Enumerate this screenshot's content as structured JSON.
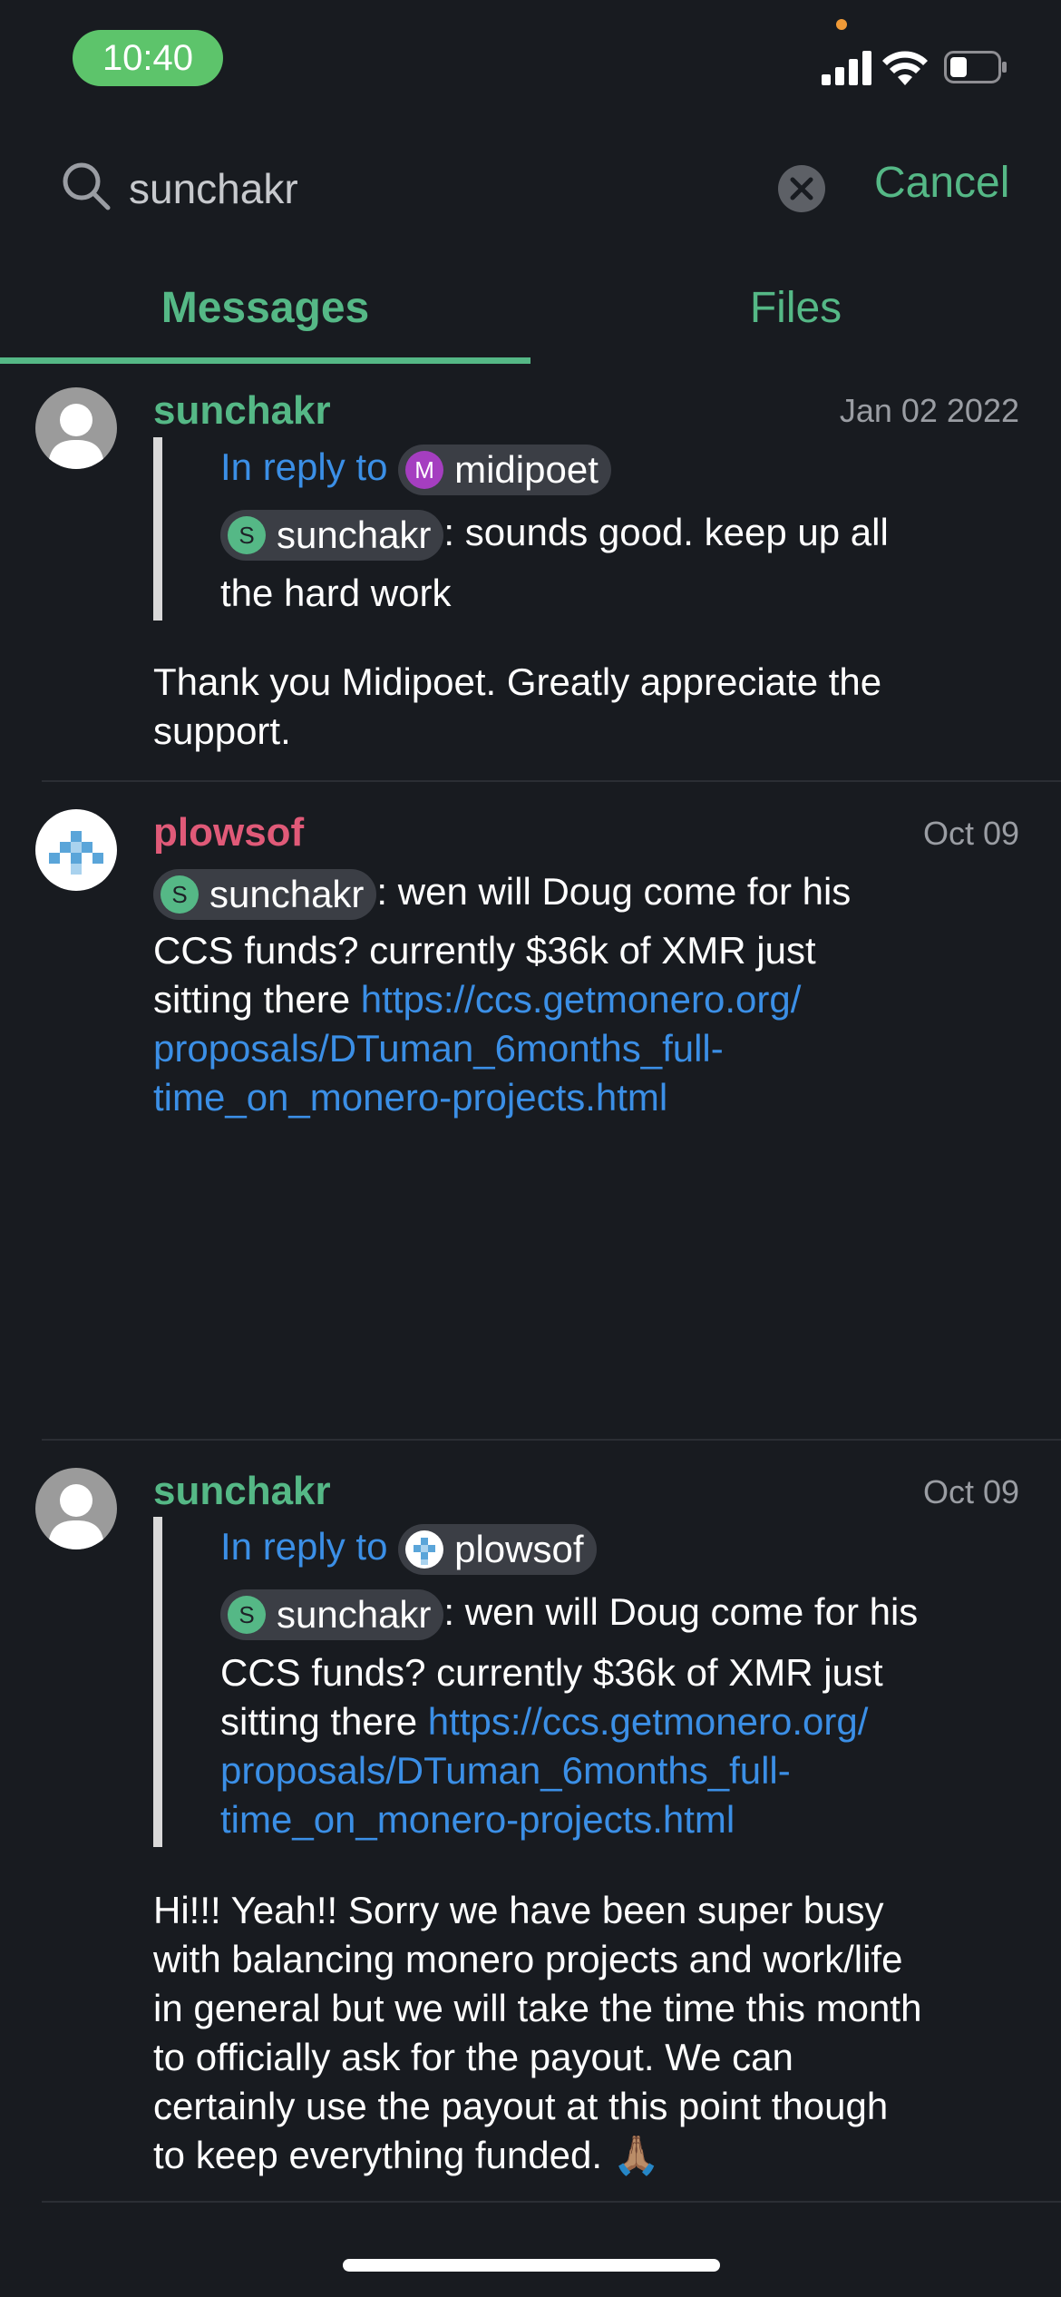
{
  "status_bar": {
    "time": "10:40"
  },
  "search": {
    "value": "sunchakr",
    "placeholder": "",
    "cancel_label": "Cancel"
  },
  "tabs": [
    {
      "label": "Messages",
      "active": true
    },
    {
      "label": "Files",
      "active": false
    }
  ],
  "messages": [
    {
      "sender": "sunchakr",
      "date": "Jan 02 2022",
      "reply": {
        "label": "In reply to",
        "user": "midipoet",
        "user_initial": "M",
        "mention": "sunchakr",
        "mention_initial": "S",
        "text_line1": ": sounds good. keep up all",
        "text_line2": "the hard work"
      },
      "body_lines": [
        "Thank you Midipoet. Greatly appreciate the",
        "support."
      ]
    },
    {
      "sender": "plowsof",
      "date": "Oct 09",
      "mention": "sunchakr",
      "mention_initial": "S",
      "text_line1": ": wen will Doug come for his",
      "text_line2": "CCS funds? currently $36k of XMR just",
      "text_line3_prefix": "sitting there ",
      "link_lines": [
        "https://ccs.getmonero.org/",
        "proposals/DTuman_6months_full-",
        "time_on_monero-projects.html"
      ]
    },
    {
      "sender": "sunchakr",
      "date": "Oct 09",
      "reply": {
        "label": "In reply to",
        "user": "plowsof",
        "mention": "sunchakr",
        "mention_initial": "S",
        "text_line1": ": wen will Doug come for his",
        "text_line2": "CCS funds? currently $36k of XMR just",
        "text_line3_prefix": "sitting there ",
        "link_lines": [
          "https://ccs.getmonero.org/",
          "proposals/DTuman_6months_full-",
          "time_on_monero-projects.html"
        ]
      },
      "body_lines": [
        "Hi!!! Yeah!! Sorry we have been super busy",
        "with balancing monero projects and work/life",
        "in general but we will take the time this month",
        "to officially ask for the payout. We can",
        "certainly use the payout at this point though",
        "to keep everything funded. 🙏🏽"
      ]
    }
  ],
  "colors": {
    "background": "#181b20",
    "accent_green": "#55b886",
    "link_blue": "#3b8fe6",
    "sender_red": "#e05a78"
  }
}
